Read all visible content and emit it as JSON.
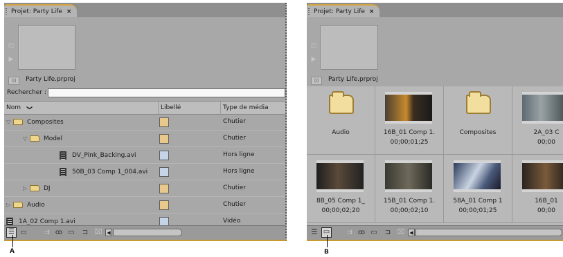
{
  "colors": {
    "accent": "#d3a540",
    "panel": "#a8a8a8",
    "folder_label": "#e8c98b",
    "video_label": "#c5d4e6"
  },
  "panel_list": {
    "tab_label": "Projet: Party Life",
    "tab_close": "×",
    "project_file": "Party Life.prproj",
    "search_label": "Rechercher :",
    "search_value": "",
    "columns": {
      "name": "Nom",
      "sort_icon": "❯",
      "label": "Libellé",
      "media_type": "Type de média"
    },
    "rows": [
      {
        "name": "Composites",
        "type": "folder",
        "expander": "▽",
        "label_color": "#e8c98b",
        "media_type": "Chutier"
      },
      {
        "name": "Model",
        "type": "folder",
        "expander": "▽",
        "label_color": "#e8c98b",
        "media_type": "Chutier"
      },
      {
        "name": "DV_Pink_Backing.avi",
        "type": "video",
        "expander": "",
        "label_color": "#c5d4e6",
        "media_type": "Hors ligne"
      },
      {
        "name": "50B_03 Comp 1_004.avi",
        "type": "video",
        "expander": "",
        "label_color": "#c5d4e6",
        "media_type": "Hors ligne"
      },
      {
        "name": "DJ",
        "type": "folder",
        "expander": "▷",
        "label_color": "#e8c98b",
        "media_type": "Chutier"
      },
      {
        "name": "Audio",
        "type": "folder",
        "expander": "▷",
        "label_color": "#e8c98b",
        "media_type": "Chutier"
      },
      {
        "name": "1A_02 Comp 1.avi",
        "type": "video",
        "expander": "",
        "label_color": "#c5d4e6",
        "media_type": "Vidéo"
      }
    ],
    "callout": "A"
  },
  "panel_icon": {
    "tab_label": "Projet: Party Life",
    "tab_close": "×",
    "project_file": "Party Life.prproj",
    "items": [
      {
        "title": "Audio",
        "sub": "",
        "kind": "folder"
      },
      {
        "title": "16B_01 Comp 1.",
        "sub": "00;00;01;25",
        "kind": "clip"
      },
      {
        "title": "Composites",
        "sub": "",
        "kind": "folder"
      },
      {
        "title": "2A_03 C",
        "sub": "00;00",
        "kind": "clip"
      },
      {
        "title": "8B_05 Comp 1_",
        "sub": "00;00;02;20",
        "kind": "clip"
      },
      {
        "title": "15B_01 Comp 1.",
        "sub": "00;00;02;10",
        "kind": "clip"
      },
      {
        "title": "58A_01 Comp 1",
        "sub": "00;00;01;25",
        "kind": "clip"
      },
      {
        "title": "16B_01",
        "sub": "00;00",
        "kind": "clip"
      }
    ],
    "callout": "B"
  },
  "icons": {
    "list_view": "list-view-icon",
    "icon_view": "icon-view-icon",
    "automate": "automate-to-sequence-icon",
    "find": "find-icon",
    "new_bin": "new-bin-icon",
    "new_item": "new-item-icon",
    "clear": "clear-icon"
  }
}
